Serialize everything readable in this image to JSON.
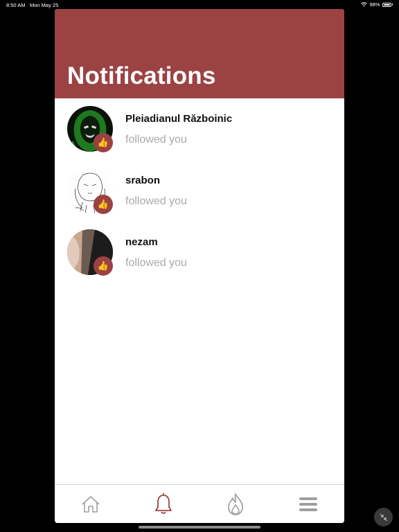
{
  "status_bar": {
    "time": "8:50 AM",
    "date": "Mon May 25",
    "battery": "98%"
  },
  "header": {
    "title": "Notifications"
  },
  "notifications": [
    {
      "name": "Pleiadianul Războinic",
      "action": "followed you"
    },
    {
      "name": "srabon",
      "action": "followed you"
    },
    {
      "name": "nezam",
      "action": "followed you"
    }
  ],
  "tabbar": {
    "tabs": [
      {
        "icon": "home-icon",
        "active": false
      },
      {
        "icon": "bell-icon",
        "active": true
      },
      {
        "icon": "flame-icon",
        "active": false
      },
      {
        "icon": "menu-icon",
        "active": false
      }
    ]
  },
  "colors": {
    "accent": "#9b4243",
    "muted": "#a9a9a9",
    "icon_inactive": "#9e9e9e"
  }
}
